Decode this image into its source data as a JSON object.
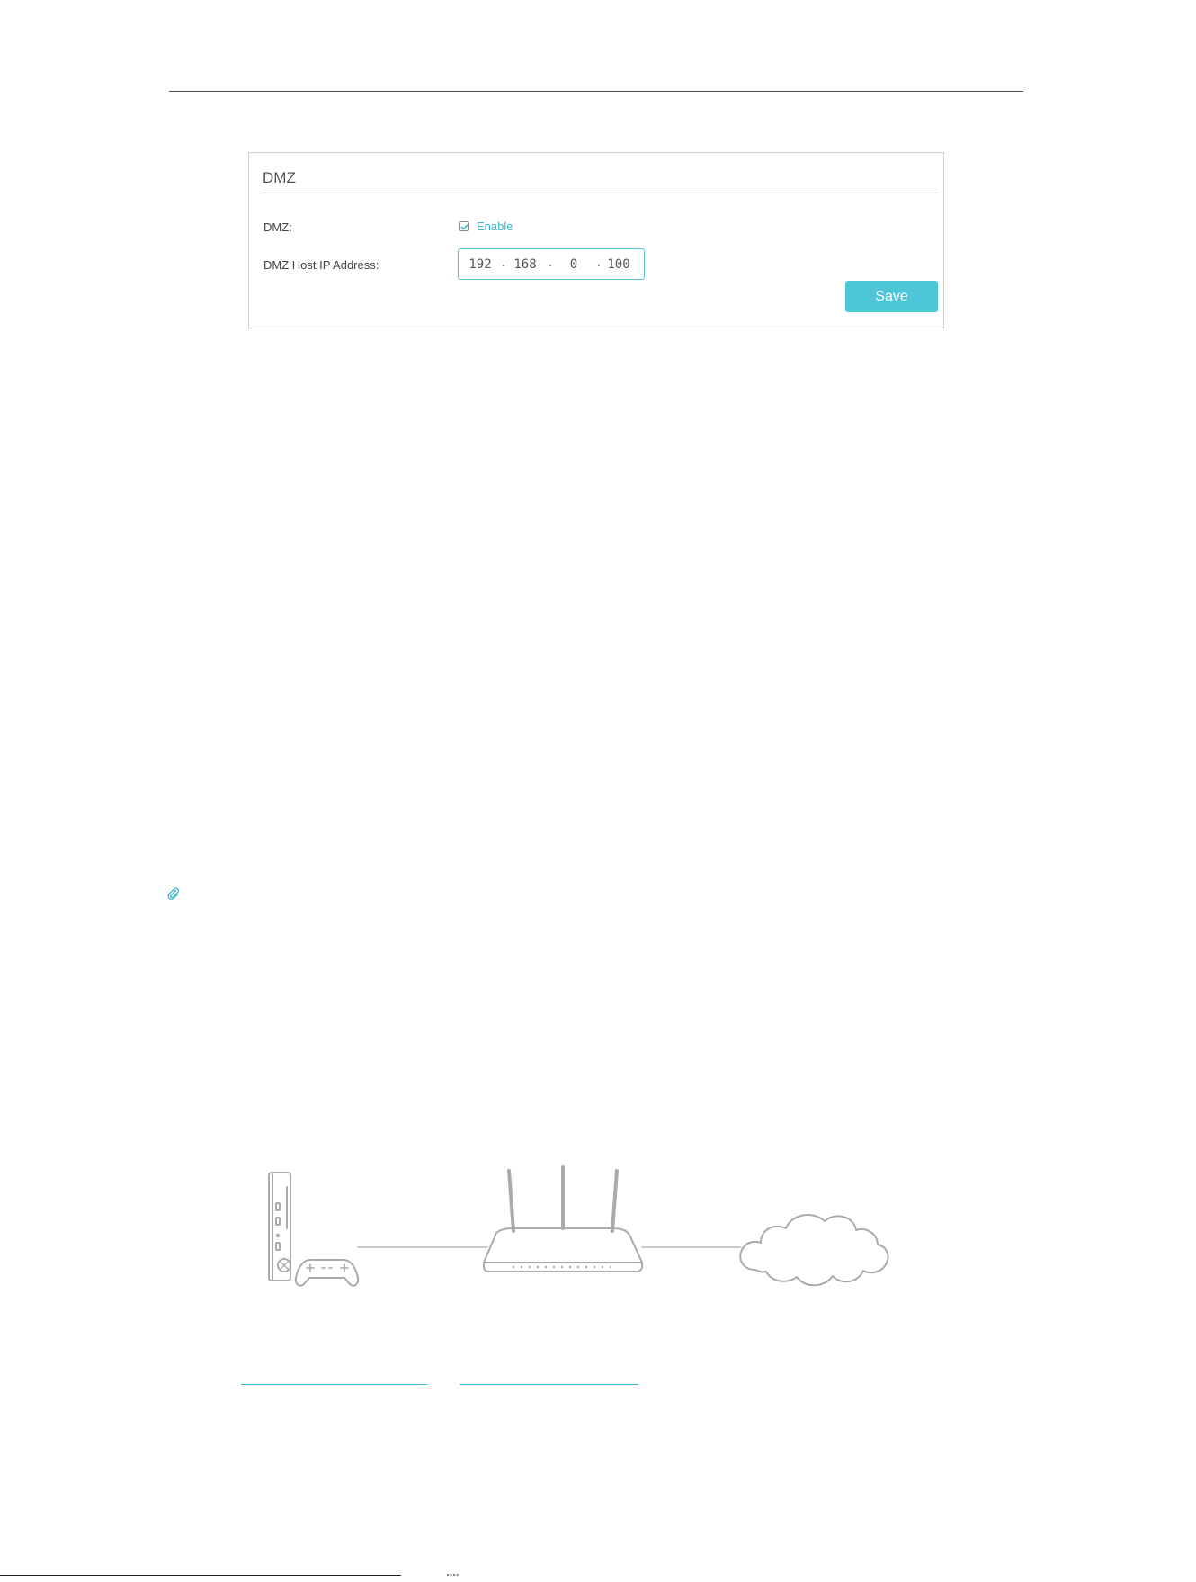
{
  "dmz_panel": {
    "title": "DMZ",
    "dmz_label": "DMZ:",
    "enable_label": "Enable",
    "enable_checked": true,
    "host_ip_label": "DMZ Host IP Address:",
    "host_ip": [
      "192",
      "168",
      "0",
      "100"
    ],
    "ip_separator": ".",
    "save_label": "Save"
  },
  "colors": {
    "accent": "#4dc6d8",
    "link": "#3cb8cf",
    "diagram_stroke": "#aaaaaa"
  },
  "icons": {
    "note": "paperclip-icon",
    "checkbox": "checkmark-icon"
  },
  "diagram": {
    "devices": [
      "game-console",
      "router",
      "internet-cloud"
    ]
  }
}
